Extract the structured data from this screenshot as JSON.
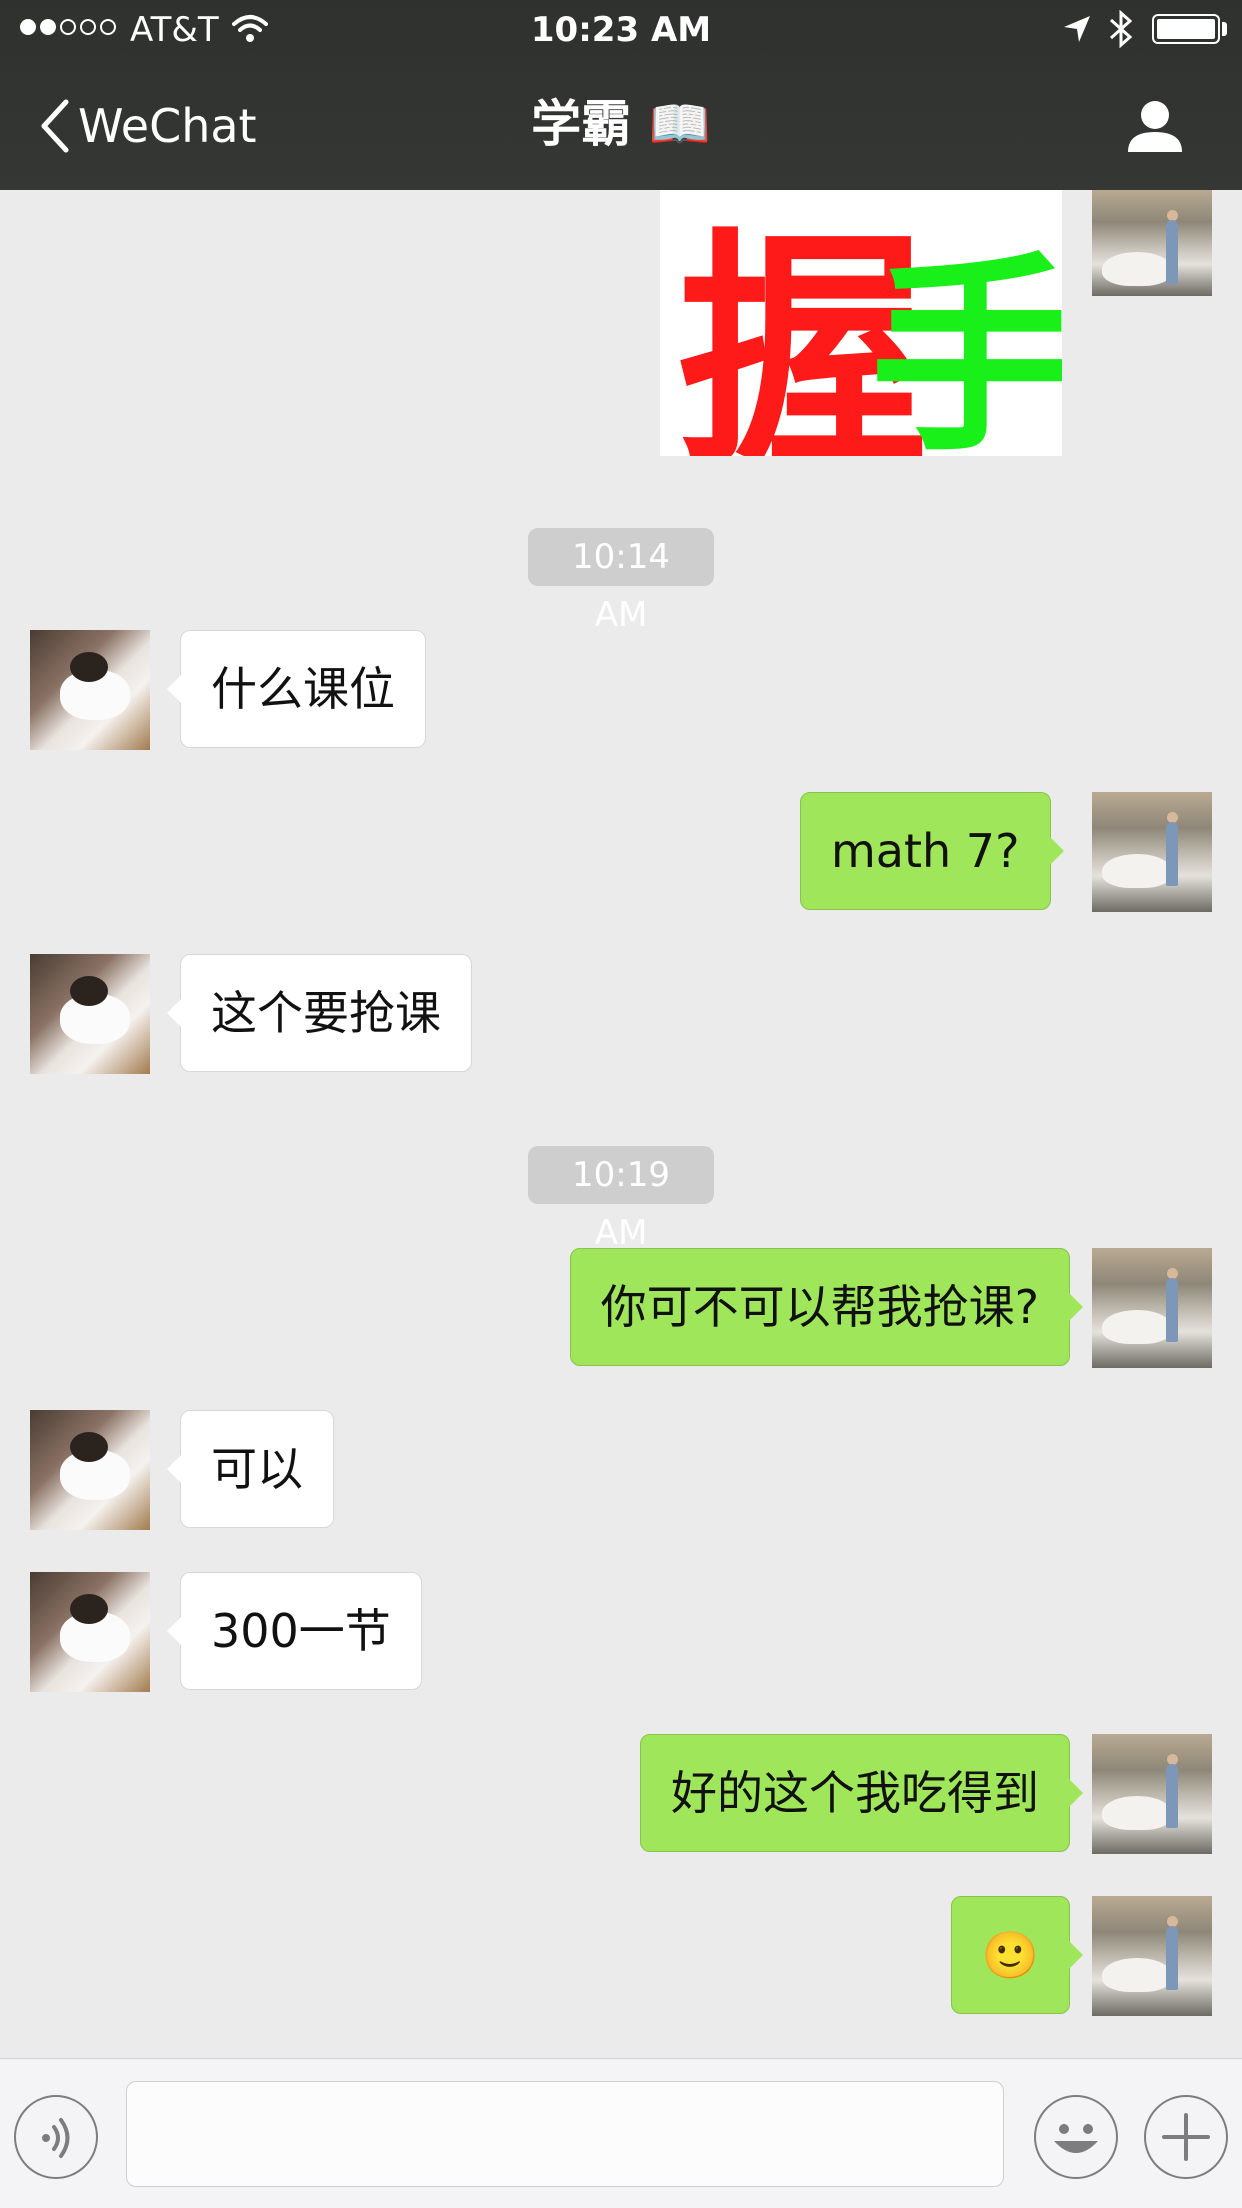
{
  "status_bar": {
    "carrier": "AT&T",
    "time": "10:23 AM",
    "signal_strength": 2,
    "icons": [
      "wifi-icon",
      "location-arrow-icon",
      "bluetooth-icon",
      "battery-icon"
    ]
  },
  "nav": {
    "back_label": "WeChat",
    "title": "学霸 📖",
    "icons": [
      "chevron-left-icon",
      "person-icon"
    ]
  },
  "sticker": {
    "chars": [
      "握",
      "手"
    ],
    "colors": [
      "#ff1a1a",
      "#19f01a"
    ]
  },
  "messages": [
    {
      "type": "timestamp",
      "text": "10:14 AM"
    },
    {
      "type": "incoming",
      "text": "什么课位"
    },
    {
      "type": "outgoing",
      "text": "math 7?"
    },
    {
      "type": "incoming",
      "text": "这个要抢课"
    },
    {
      "type": "timestamp",
      "text": "10:19 AM"
    },
    {
      "type": "outgoing",
      "text": "你可不可以帮我抢课?"
    },
    {
      "type": "incoming",
      "text": "可以"
    },
    {
      "type": "incoming",
      "text": "300一节"
    },
    {
      "type": "outgoing",
      "text": "好的这个我吃得到"
    },
    {
      "type": "outgoing",
      "text": "🙂"
    }
  ],
  "input_bar": {
    "message_value": "",
    "icons": [
      "voice-icon",
      "emoji-icon",
      "plus-icon"
    ]
  },
  "colors": {
    "header_bg": "#333532",
    "chat_bg": "#ebebeb",
    "outgoing_bubble": "#9fe65b",
    "incoming_bubble": "#ffffff",
    "timestamp_bg": "#cecece"
  }
}
